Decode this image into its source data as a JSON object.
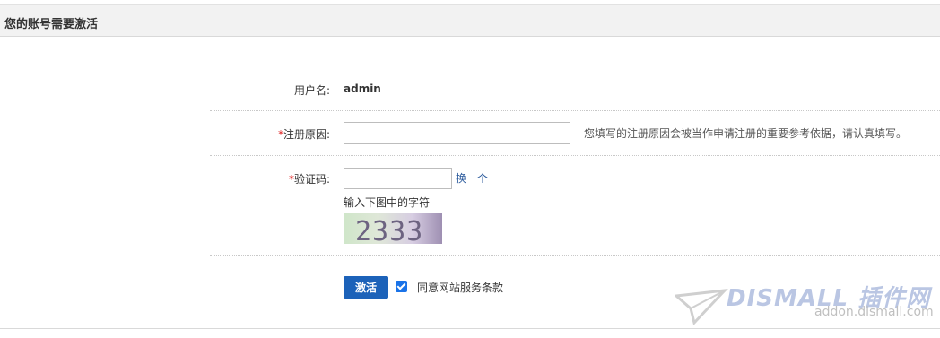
{
  "header": {
    "title": "您的账号需要激活"
  },
  "form": {
    "username": {
      "label": "用户名:",
      "value": "admin"
    },
    "reason": {
      "required_mark": "*",
      "label": "注册原因:",
      "value": "",
      "hint": "您填写的注册原因会被当作申请注册的重要参考依据，请认真填写。"
    },
    "captcha": {
      "required_mark": "*",
      "label": "验证码:",
      "value": "",
      "refresh_link": "换一个",
      "tip": "输入下图中的字符",
      "image_text": "2333"
    },
    "submit_label": "激活",
    "agree_checked": true,
    "agree_label": "同意网站服务条款"
  },
  "watermark": {
    "brand_text": "DISMALL 插件网",
    "url_text": "addon.dismall.com"
  },
  "colors": {
    "button": "#1c62b9",
    "link": "#2b5a9c",
    "required": "#e02020",
    "checkbox": "#1a73e8"
  }
}
